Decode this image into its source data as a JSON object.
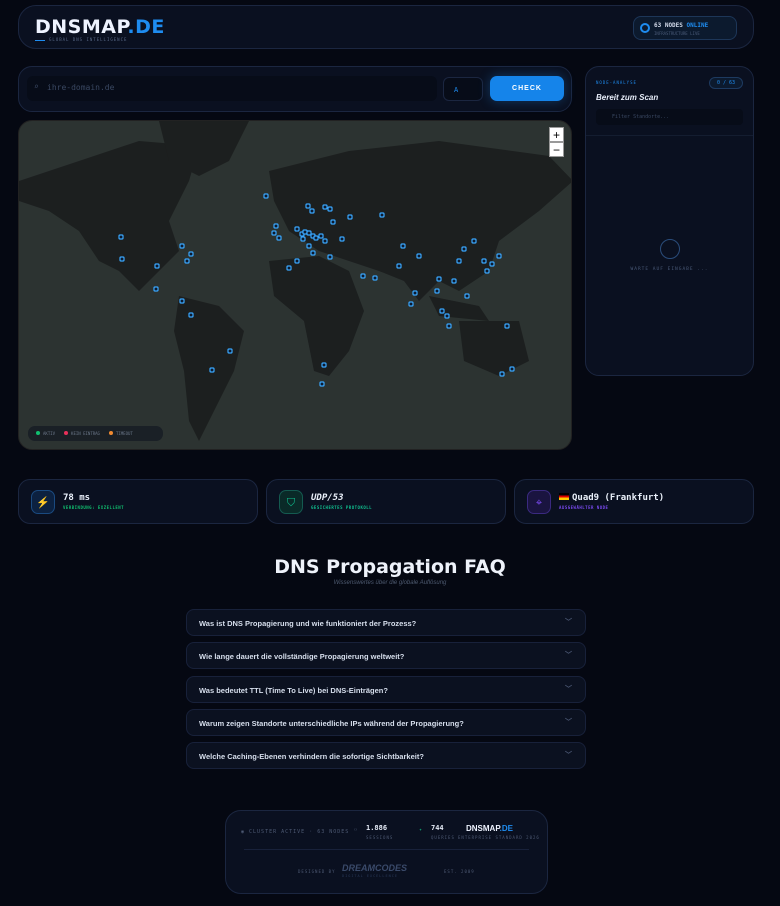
{
  "header": {
    "logo_main": "DNSMAP",
    "logo_tld": ".DE",
    "tagline": "GLOBAL DNS INTELLIGENCE",
    "status_count": "63 NODES",
    "status_state": "ONLINE",
    "status_sub": "INFRASTRUCTURE LIVE"
  },
  "search": {
    "placeholder": "ihre-domain.de",
    "record_type": "A",
    "check_label": "CHECK"
  },
  "map": {
    "zoom_in": "+",
    "zoom_out": "−",
    "legend": [
      {
        "label": "AKTIV",
        "color": "#10c070"
      },
      {
        "label": "KEIN EINTRAG",
        "color": "#e8305a"
      },
      {
        "label": "TIMEOUT",
        "color": "#f08a30"
      }
    ]
  },
  "sidebar": {
    "section": "NODE-ANALYSE",
    "count": "0 / 63",
    "title": "Bereit zum Scan",
    "filter_placeholder": "Filter Standorte...",
    "waiting": "WARTE AUF EINGABE ..."
  },
  "stats": [
    {
      "value": "78 ms",
      "label": "VERBINDUNG: EXZELLENT",
      "icon": "bolt-icon",
      "color": "#1e8cf0"
    },
    {
      "value": "UDP/53",
      "label": "GESICHERTES PROTOKOLL",
      "icon": "shield-icon",
      "color": "#10c090"
    },
    {
      "value": "Quad9 (Frankfurt)",
      "label": "AUSGEWÄHLTER NODE",
      "icon": "map-pin-icon",
      "color": "#7a4af0",
      "flag": "de"
    }
  ],
  "faq": {
    "title": "DNS Propagation FAQ",
    "subtitle": "Wissenswertes über die globale Auflösung",
    "items": [
      "Was ist DNS Propagierung und wie funktioniert der Prozess?",
      "Wie lange dauert die vollständige Propagierung weltweit?",
      "Was bedeutet TTL (Time To Live) bei DNS-Einträgen?",
      "Warum zeigen Standorte unterschiedliche IPs während der Propagierung?",
      "Welche Caching-Ebenen verhindern die sofortige Sichtbarkeit?"
    ]
  },
  "footer": {
    "cluster": "CLUSTER ACTIVE",
    "nodes": "63 NODES",
    "sessions_value": "1.886",
    "sessions_label": "SESSIONS",
    "queries_value": "744",
    "queries_label": "QUERIES",
    "logo_main": "DNSMAP",
    "logo_tld": ".DE",
    "standard": "ENTERPRISE STANDARD 2026",
    "designed_by": "DESIGNED BY",
    "brand": "DREAMCODES",
    "brand_sub": "DIGITAL EXCELLENCE",
    "est": "EST. 2009"
  }
}
